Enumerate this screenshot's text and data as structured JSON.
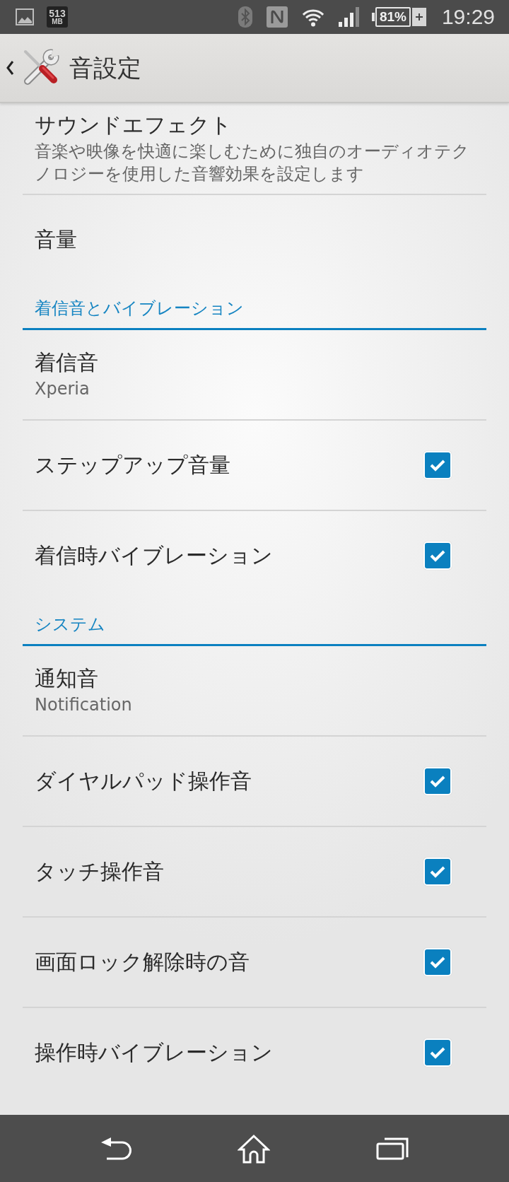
{
  "status_bar": {
    "memory_value": "513",
    "memory_unit": "MB",
    "battery": "81%",
    "time": "19:29"
  },
  "action_bar": {
    "title": "音設定"
  },
  "sections": [
    {
      "items": [
        {
          "kind": "text",
          "title": "サウンドエフェクト",
          "summary": "音楽や映像を快適に楽しむために独自のオーディオテクノロジーを使用した音響効果を設定します"
        },
        {
          "kind": "text",
          "title": "音量"
        }
      ]
    },
    {
      "header": "着信音とバイブレーション",
      "items": [
        {
          "kind": "text",
          "title": "着信音",
          "summary": "Xperia"
        },
        {
          "kind": "checkbox",
          "title": "ステップアップ音量",
          "checked": true
        },
        {
          "kind": "checkbox",
          "title": "着信時バイブレーション",
          "checked": true
        }
      ]
    },
    {
      "header": "システム",
      "items": [
        {
          "kind": "text",
          "title": "通知音",
          "summary": "Notification"
        },
        {
          "kind": "checkbox",
          "title": "ダイヤルパッド操作音",
          "checked": true
        },
        {
          "kind": "checkbox",
          "title": "タッチ操作音",
          "checked": true
        },
        {
          "kind": "checkbox",
          "title": "画面ロック解除時の音",
          "checked": true
        },
        {
          "kind": "checkbox",
          "title": "操作時バイブレーション",
          "checked": true
        }
      ]
    }
  ]
}
